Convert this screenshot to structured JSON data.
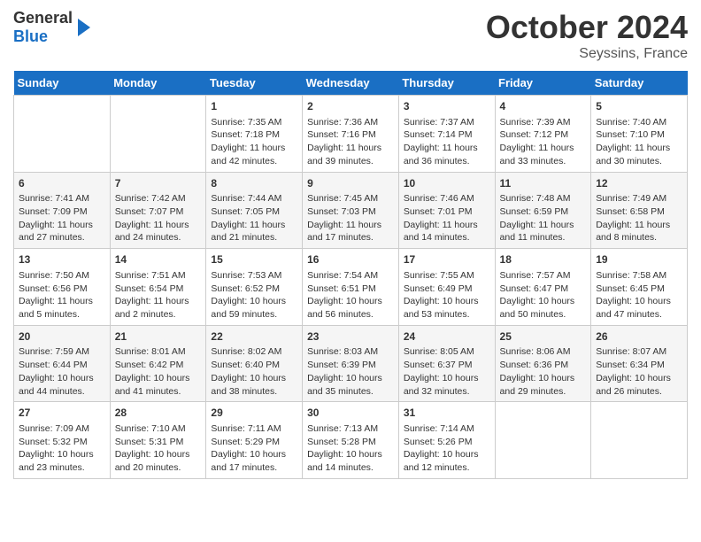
{
  "header": {
    "logo_general": "General",
    "logo_blue": "Blue",
    "month_title": "October 2024",
    "location": "Seyssins, France"
  },
  "days_of_week": [
    "Sunday",
    "Monday",
    "Tuesday",
    "Wednesday",
    "Thursday",
    "Friday",
    "Saturday"
  ],
  "weeks": [
    [
      {
        "day": "",
        "info": ""
      },
      {
        "day": "",
        "info": ""
      },
      {
        "day": "1",
        "info": "Sunrise: 7:35 AM\nSunset: 7:18 PM\nDaylight: 11 hours and 42 minutes."
      },
      {
        "day": "2",
        "info": "Sunrise: 7:36 AM\nSunset: 7:16 PM\nDaylight: 11 hours and 39 minutes."
      },
      {
        "day": "3",
        "info": "Sunrise: 7:37 AM\nSunset: 7:14 PM\nDaylight: 11 hours and 36 minutes."
      },
      {
        "day": "4",
        "info": "Sunrise: 7:39 AM\nSunset: 7:12 PM\nDaylight: 11 hours and 33 minutes."
      },
      {
        "day": "5",
        "info": "Sunrise: 7:40 AM\nSunset: 7:10 PM\nDaylight: 11 hours and 30 minutes."
      }
    ],
    [
      {
        "day": "6",
        "info": "Sunrise: 7:41 AM\nSunset: 7:09 PM\nDaylight: 11 hours and 27 minutes."
      },
      {
        "day": "7",
        "info": "Sunrise: 7:42 AM\nSunset: 7:07 PM\nDaylight: 11 hours and 24 minutes."
      },
      {
        "day": "8",
        "info": "Sunrise: 7:44 AM\nSunset: 7:05 PM\nDaylight: 11 hours and 21 minutes."
      },
      {
        "day": "9",
        "info": "Sunrise: 7:45 AM\nSunset: 7:03 PM\nDaylight: 11 hours and 17 minutes."
      },
      {
        "day": "10",
        "info": "Sunrise: 7:46 AM\nSunset: 7:01 PM\nDaylight: 11 hours and 14 minutes."
      },
      {
        "day": "11",
        "info": "Sunrise: 7:48 AM\nSunset: 6:59 PM\nDaylight: 11 hours and 11 minutes."
      },
      {
        "day": "12",
        "info": "Sunrise: 7:49 AM\nSunset: 6:58 PM\nDaylight: 11 hours and 8 minutes."
      }
    ],
    [
      {
        "day": "13",
        "info": "Sunrise: 7:50 AM\nSunset: 6:56 PM\nDaylight: 11 hours and 5 minutes."
      },
      {
        "day": "14",
        "info": "Sunrise: 7:51 AM\nSunset: 6:54 PM\nDaylight: 11 hours and 2 minutes."
      },
      {
        "day": "15",
        "info": "Sunrise: 7:53 AM\nSunset: 6:52 PM\nDaylight: 10 hours and 59 minutes."
      },
      {
        "day": "16",
        "info": "Sunrise: 7:54 AM\nSunset: 6:51 PM\nDaylight: 10 hours and 56 minutes."
      },
      {
        "day": "17",
        "info": "Sunrise: 7:55 AM\nSunset: 6:49 PM\nDaylight: 10 hours and 53 minutes."
      },
      {
        "day": "18",
        "info": "Sunrise: 7:57 AM\nSunset: 6:47 PM\nDaylight: 10 hours and 50 minutes."
      },
      {
        "day": "19",
        "info": "Sunrise: 7:58 AM\nSunset: 6:45 PM\nDaylight: 10 hours and 47 minutes."
      }
    ],
    [
      {
        "day": "20",
        "info": "Sunrise: 7:59 AM\nSunset: 6:44 PM\nDaylight: 10 hours and 44 minutes."
      },
      {
        "day": "21",
        "info": "Sunrise: 8:01 AM\nSunset: 6:42 PM\nDaylight: 10 hours and 41 minutes."
      },
      {
        "day": "22",
        "info": "Sunrise: 8:02 AM\nSunset: 6:40 PM\nDaylight: 10 hours and 38 minutes."
      },
      {
        "day": "23",
        "info": "Sunrise: 8:03 AM\nSunset: 6:39 PM\nDaylight: 10 hours and 35 minutes."
      },
      {
        "day": "24",
        "info": "Sunrise: 8:05 AM\nSunset: 6:37 PM\nDaylight: 10 hours and 32 minutes."
      },
      {
        "day": "25",
        "info": "Sunrise: 8:06 AM\nSunset: 6:36 PM\nDaylight: 10 hours and 29 minutes."
      },
      {
        "day": "26",
        "info": "Sunrise: 8:07 AM\nSunset: 6:34 PM\nDaylight: 10 hours and 26 minutes."
      }
    ],
    [
      {
        "day": "27",
        "info": "Sunrise: 7:09 AM\nSunset: 5:32 PM\nDaylight: 10 hours and 23 minutes."
      },
      {
        "day": "28",
        "info": "Sunrise: 7:10 AM\nSunset: 5:31 PM\nDaylight: 10 hours and 20 minutes."
      },
      {
        "day": "29",
        "info": "Sunrise: 7:11 AM\nSunset: 5:29 PM\nDaylight: 10 hours and 17 minutes."
      },
      {
        "day": "30",
        "info": "Sunrise: 7:13 AM\nSunset: 5:28 PM\nDaylight: 10 hours and 14 minutes."
      },
      {
        "day": "31",
        "info": "Sunrise: 7:14 AM\nSunset: 5:26 PM\nDaylight: 10 hours and 12 minutes."
      },
      {
        "day": "",
        "info": ""
      },
      {
        "day": "",
        "info": ""
      }
    ]
  ]
}
